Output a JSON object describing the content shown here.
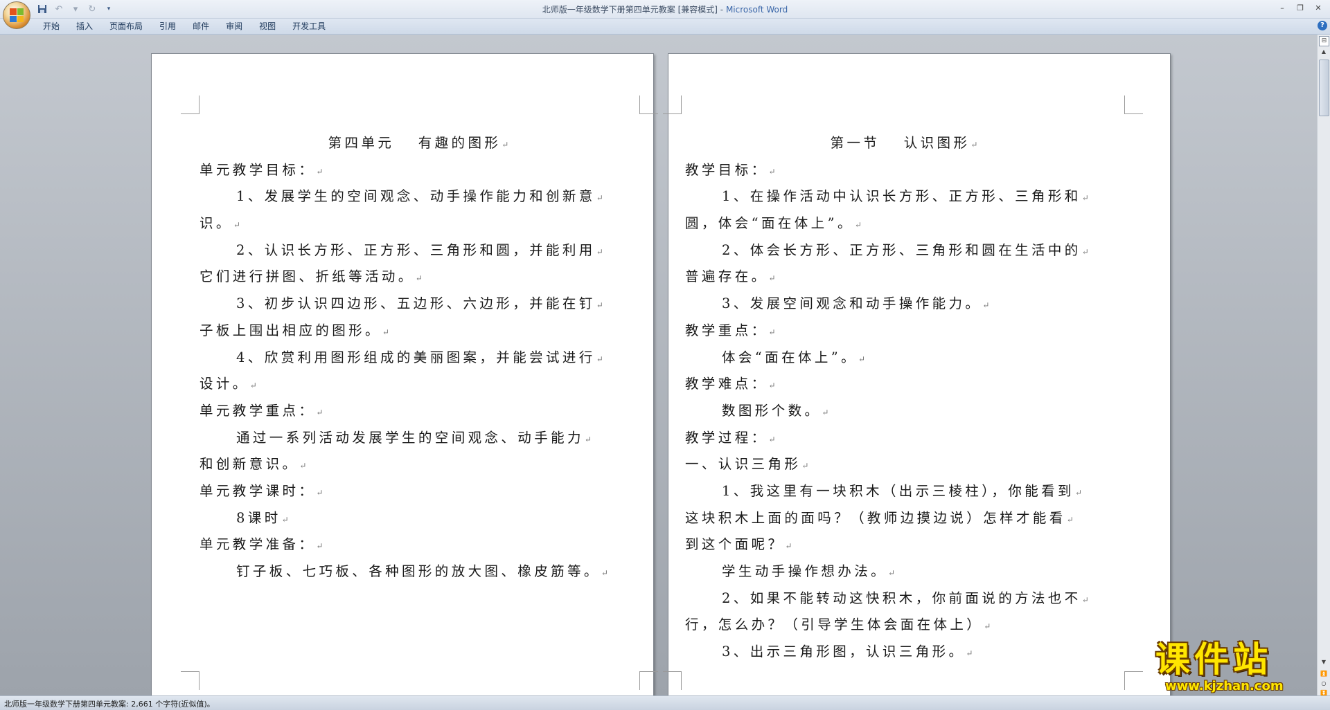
{
  "window": {
    "title": "北师版一年级数学下册第四单元教案 [兼容模式]",
    "title_sep": " - ",
    "app_name": "Microsoft Word",
    "accent": "#3a66a8"
  },
  "quick_access": {
    "save_icon": "save-icon",
    "undo_icon": "undo-icon",
    "redo_icon": "redo-icon",
    "customize_icon": "chevron-down-icon"
  },
  "ribbon": {
    "tabs": [
      "开始",
      "插入",
      "页面布局",
      "引用",
      "邮件",
      "审阅",
      "视图",
      "开发工具"
    ]
  },
  "left_page": {
    "lines": [
      "第四单元　 有趣的图形",
      "单元教学目标：",
      "1、发展学生的空间观念、动手操作能力和创新意",
      "识。",
      "2、认识长方形、正方形、三角形和圆，并能利用",
      "它们进行拼图、折纸等活动。",
      "3、初步认识四边形、五边形、六边形，并能在钉",
      "子板上围出相应的图形。",
      "4、欣赏利用图形组成的美丽图案，并能尝试进行",
      "设计。",
      "单元教学重点：",
      "通过一系列活动发展学生的空间观念、动手能力",
      "和创新意识。",
      "单元教学课时：",
      "8课时",
      "单元教学准备：",
      "钉子板、七巧板、各种图形的放大图、橡皮筋等。"
    ]
  },
  "right_page": {
    "lines": [
      "第一节　 认识图形",
      "教学目标：",
      "1、在操作活动中认识长方形、正方形、三角形和",
      "圆，体会“面在体上”。",
      "2、体会长方形、正方形、三角形和圆在生活中的",
      "普遍存在。",
      "3、发展空间观念和动手操作能力。",
      "教学重点：",
      "体会“面在体上”。",
      "教学难点：",
      "数图形个数。",
      "教学过程：",
      "一、认识三角形",
      "1、我这里有一块积木（出示三棱柱），你能看到",
      "这块积木上面的面吗？（教师边摸边说）怎样才能看",
      "到这个面呢？",
      "学生动手操作想办法。",
      "2、如果不能转动这快积木，你前面说的方法也不",
      "行，怎么办？（引导学生体会面在体上）",
      "3、出示三角形图，认识三角形。"
    ]
  },
  "status_bar": {
    "text": "北师版一年级数学下册第四单元教案: 2,661 个字符(近似值)。"
  },
  "watermark": {
    "brand": "课件站",
    "url": "www.kjzhan.com",
    "color": "#ffe600"
  }
}
